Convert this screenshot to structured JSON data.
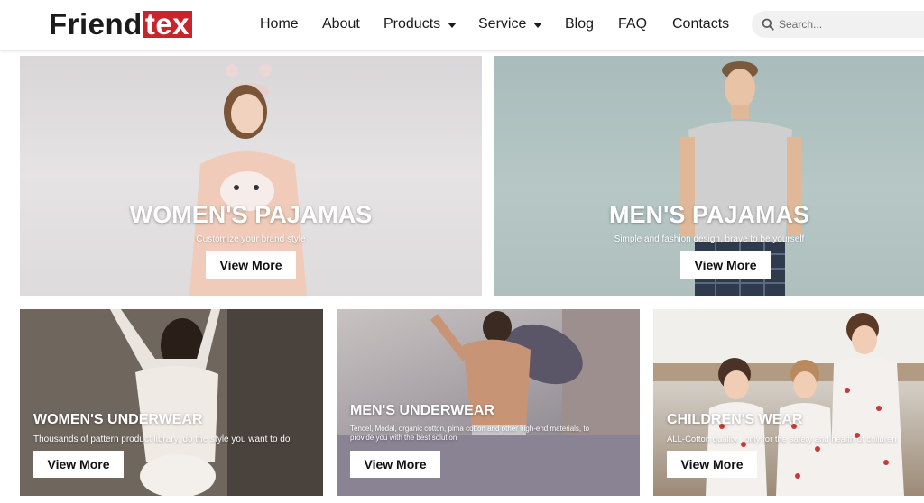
{
  "brand": {
    "part1": "Friend",
    "part2": "tex",
    "accent": "#c8242c"
  },
  "nav": {
    "home": "Home",
    "about": "About",
    "products": "Products",
    "service": "Service",
    "blog": "Blog",
    "faq": "FAQ",
    "contacts": "Contacts"
  },
  "search": {
    "placeholder": "Search...",
    "icon": "search-icon"
  },
  "tiles": {
    "women_pajamas": {
      "title": "WOMEN'S PAJAMAS",
      "subtitle": "Customize your brand style",
      "button": "View More"
    },
    "men_pajamas": {
      "title": "MEN'S PAJAMAS",
      "subtitle": "Simple and fashion design, brave to be yourself",
      "button": "View More"
    },
    "women_underwear": {
      "title": "WOMEN'S UNDERWEAR",
      "subtitle": "Thousands of pattern product library, do the style you want to do",
      "button": "View More"
    },
    "men_underwear": {
      "title": "MEN'S UNDERWEAR",
      "subtitle_line1": "Tencel, Modal, organic cotton, pima cotton and other high-end materials, to",
      "subtitle_line2": "provide you with the best solution",
      "button": "View More"
    },
    "childrens_wear": {
      "title": "CHILDREN'S WEAR",
      "subtitle": "ALL-Cotton quality , only for the safety and health of children",
      "button": "View More"
    }
  }
}
